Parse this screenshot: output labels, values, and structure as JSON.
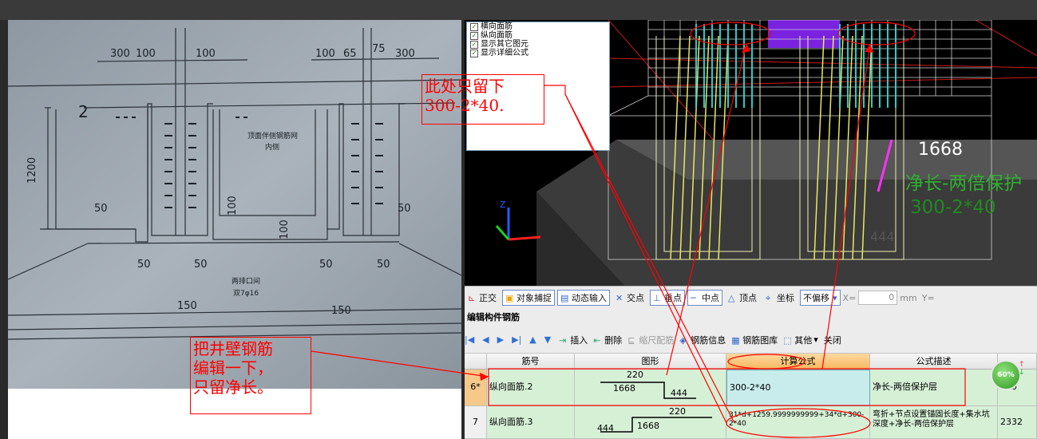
{
  "layers_panel": {
    "items": [
      {
        "label": "横向面筋",
        "checked": true
      },
      {
        "label": "纵向面筋",
        "checked": true
      },
      {
        "label": "显示其它图元",
        "checked": true
      },
      {
        "label": "显示详细公式",
        "checked": true
      }
    ]
  },
  "viewport": {
    "value_label": "1668",
    "desc_label": "净长-两倍保护",
    "formula_label": "300-2*40",
    "faded_label": "444",
    "axis_z": "Z"
  },
  "annotations": {
    "top_note": "此处只留下\n300-2*40.",
    "left_note": "把井壁钢筋\n编辑一下，\n只留净长。"
  },
  "drawing": {
    "dims": [
      "300",
      "100",
      "100",
      "100",
      "65",
      "75",
      "300",
      "1200",
      "50",
      "50",
      "100",
      "100",
      "50",
      "50",
      "50",
      "50",
      "150",
      "150",
      "2"
    ],
    "notes": [
      "顶面伴侧钢筋网",
      "内侧",
      "两排口间",
      "双7φ16"
    ]
  },
  "snap_toolbar": {
    "items": [
      "正交",
      "对象捕捉",
      "动态输入",
      "交点",
      "垂点",
      "中点",
      "顶点",
      "坐标"
    ],
    "offset_select": "不偏移",
    "x_label": "X=",
    "x_value": "0",
    "unit": "mm",
    "y_label": "Y="
  },
  "editor": {
    "title": "编辑构件钢筋",
    "tools": [
      "插入",
      "删除",
      "缩尺配筋",
      "钢筋信息",
      "钢筋图库",
      "其他",
      "关闭"
    ]
  },
  "table": {
    "headers": [
      "筋号",
      "图形",
      "计算公式",
      "公式描述"
    ],
    "rows": [
      {
        "num": "6*",
        "name": "纵向面筋.2",
        "shape": {
          "top": "220",
          "mid": "1668",
          "bottom": "444"
        },
        "formula": "300-2*40",
        "desc": "净长-两倍保护层",
        "extra": "220"
      },
      {
        "num": "7",
        "name": "纵向面筋.3",
        "shape": {
          "top": "220",
          "mid": "1668",
          "bottom": "444"
        },
        "formula": "31*d+1259.9999999999+34*d+300-2*40",
        "desc": "弯折+节点设置锚固长度+集水坑深度+净长-两倍保护层",
        "extra": "2332"
      }
    ]
  },
  "badge": {
    "percent": "60%"
  },
  "colors": {
    "annotation": "#ff0000",
    "rebar_cyan": "#30e0e0",
    "rebar_yellow": "#e8e860",
    "slab_purple": "#7a22e0",
    "selected_row": "#d6f0d6"
  }
}
